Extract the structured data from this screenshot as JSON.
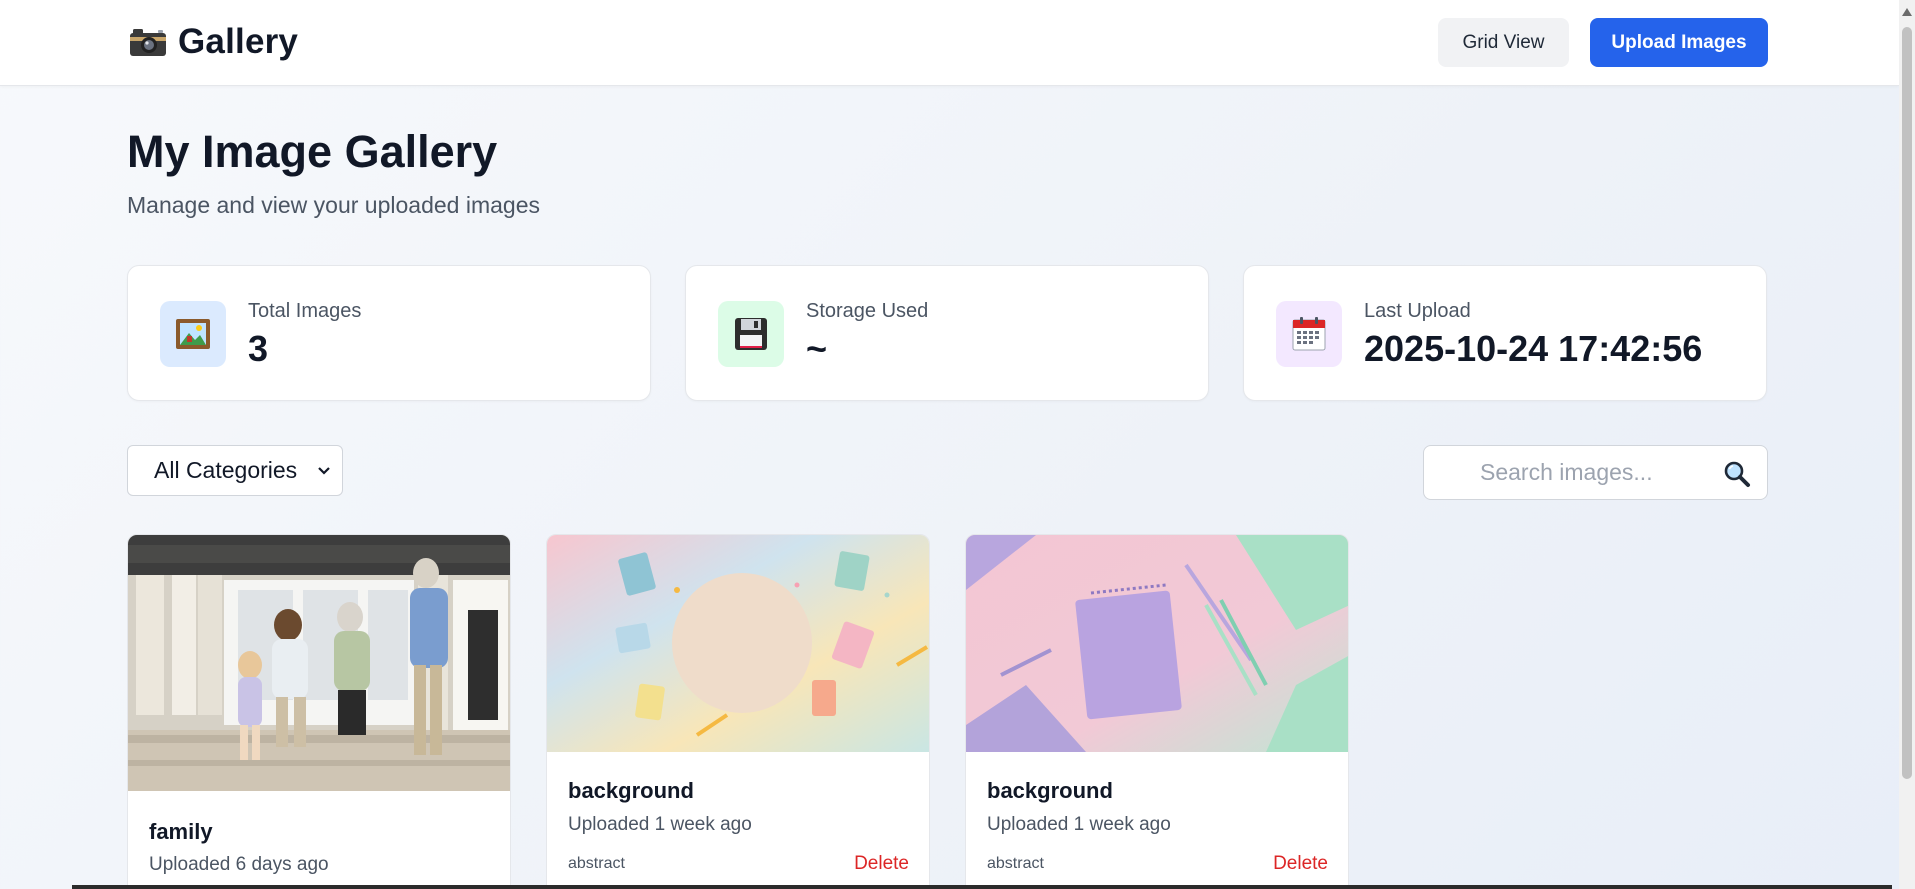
{
  "header": {
    "brand_title": "Gallery",
    "brand_icon": "camera-icon",
    "grid_view_label": "Grid View",
    "upload_label": "Upload Images",
    "accent_color": "#2563eb"
  },
  "page": {
    "title": "My Image Gallery",
    "subtitle": "Manage and view your uploaded images"
  },
  "stats": [
    {
      "label": "Total Images",
      "value": "3",
      "icon": "framed-picture-icon",
      "icon_bg": "#dbeafe"
    },
    {
      "label": "Storage Used",
      "value": "~",
      "icon": "floppy-disk-icon",
      "icon_bg": "#dcfce7"
    },
    {
      "label": "Last Upload",
      "value": "2025-10-24 17:42:56",
      "icon": "calendar-icon",
      "icon_bg": "#f3e8ff"
    }
  ],
  "filters": {
    "category_selected": "All Categories",
    "search_placeholder": "Search images...",
    "search_icon": "magnifier-icon"
  },
  "images": [
    {
      "title": "family",
      "uploaded": "Uploaded 6 days ago",
      "tag": "",
      "delete_label": ""
    },
    {
      "title": "background",
      "uploaded": "Uploaded 1 week ago",
      "tag": "abstract",
      "delete_label": "Delete"
    },
    {
      "title": "background",
      "uploaded": "Uploaded 1 week ago",
      "tag": "abstract",
      "delete_label": "Delete"
    }
  ],
  "danger_color": "#dc2626"
}
